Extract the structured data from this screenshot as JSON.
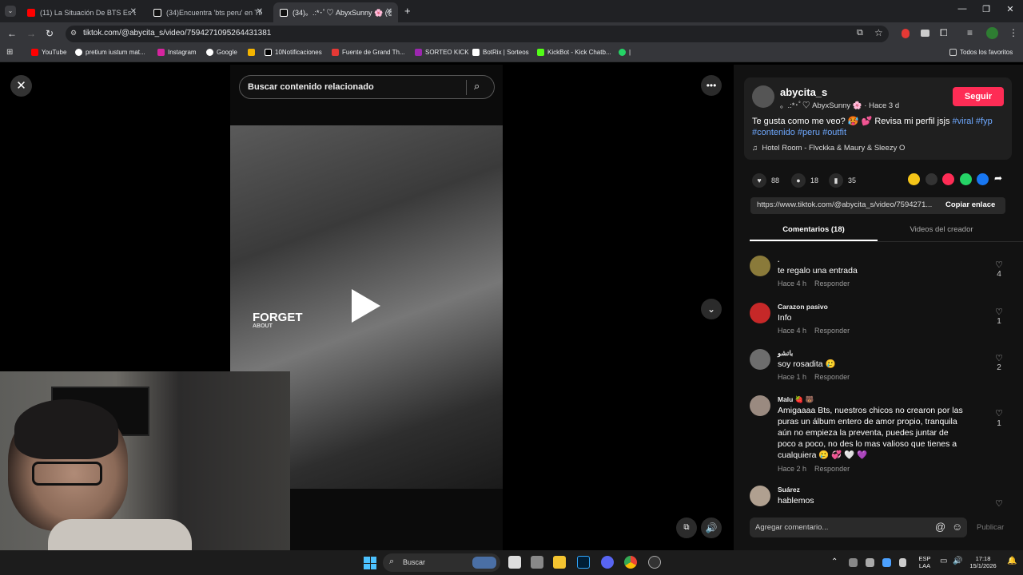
{
  "browser": {
    "tabs": [
      {
        "label": "(11) La Situación De BTS Es Una",
        "icon_color": "#ff0000",
        "active": false
      },
      {
        "label": "(34)Encuentra 'bts peru' en TikT",
        "icon_color": "#ffffff",
        "active": false
      },
      {
        "label": "(34)。.:*･ﾟ♡ AbyxSunny 🌸 (@a",
        "icon_color": "#ffffff",
        "active": true
      }
    ],
    "new_tab_label": "+",
    "url": "tiktok.com/@abycita_s/video/7594271095264431381",
    "bookmarks": [
      {
        "label": "YouTube",
        "color": "#ff0000"
      },
      {
        "label": "pretium iustum mat...",
        "color": "#ffffff"
      },
      {
        "label": "Instagram",
        "color": "#d6249f"
      },
      {
        "label": "Google",
        "color": "#4285f4"
      },
      {
        "label": "",
        "color": "#f4b400"
      },
      {
        "label": "10Notificaciones",
        "color": "#ffffff"
      },
      {
        "label": "Fuente de Grand Th...",
        "color": "#e53935"
      },
      {
        "label": "SORTEO KICK",
        "color": "#9c27b0"
      },
      {
        "label": "BotRix | Sorteos",
        "color": "#ffffff"
      },
      {
        "label": "KickBot - Kick Chatb...",
        "color": "#53fc18"
      },
      {
        "label": "|",
        "color": "#25d366"
      }
    ],
    "all_bookmarks_label": "Todos los favoritos"
  },
  "video": {
    "search_placeholder": "Buscar contenido relacionado",
    "overlay_text": "FORGET",
    "overlay_sub": "ABOUT"
  },
  "post": {
    "username": "abycita_s",
    "display_name": "。.:*･ﾟ♡ AbyxSunny 🌸",
    "time_ago": "· Hace 3 d",
    "follow_label": "Seguir",
    "caption": "Te gusta como me veo? 🥵 💕 Revisa mi perfil jsjs",
    "hashtags_line1": "#viral #fyp",
    "hashtags_line2": "#contenido #peru #outfit",
    "music": "Hotel Room - Flvckka & Maury & Sleezy O",
    "likes": "88",
    "comments": "18",
    "saves": "35",
    "share_url": "https://www.tiktok.com/@abycita_s/video/7594271...",
    "copy_label": "Copiar enlace",
    "tab_comments": "Comentarios (18)",
    "tab_creator": "Videos del creador"
  },
  "comments": [
    {
      "name": ".",
      "text": "te regalo una entrada",
      "time": "Hace 4 h",
      "reply": "Responder",
      "likes": "4",
      "avatar_color": "#8a7a3a"
    },
    {
      "name": "Carazon pasivo",
      "text": "Info",
      "time": "Hace 4 h",
      "reply": "Responder",
      "likes": "1",
      "avatar_color": "#c62828"
    },
    {
      "name": "باتشو",
      "text": "soy rosadita 🥲",
      "time": "Hace 1 h",
      "reply": "Responder",
      "likes": "2",
      "avatar_color": "#6d6d6d"
    },
    {
      "name": "Malu 🍓 🐻",
      "text": "Amigaaaa Bts, nuestros chicos no crearon por las puras un álbum entero de amor propio, tranquila aún no empieza la preventa, puedes juntar de poco a poco, no des lo mas valioso que tienes a cualquiera 🥲 💞 🤍 💜",
      "time": "Hace 2 h",
      "reply": "Responder",
      "likes": "1",
      "avatar_color": "#9a8a80"
    },
    {
      "name": "Suárez",
      "text": "hablemos",
      "time": "",
      "reply": "",
      "likes": "",
      "avatar_color": "#b0a090"
    }
  ],
  "comment_input": {
    "placeholder": "Agregar comentario...",
    "publish_label": "Publicar"
  },
  "taskbar": {
    "search_label": "Buscar",
    "lang_top": "ESP",
    "lang_bottom": "LAA",
    "time": "17:18",
    "date": "15/1/2026"
  },
  "colors": {
    "accent": "#fe2c55",
    "hashtag": "#6ea8fe",
    "panel_bg": "#121212"
  }
}
